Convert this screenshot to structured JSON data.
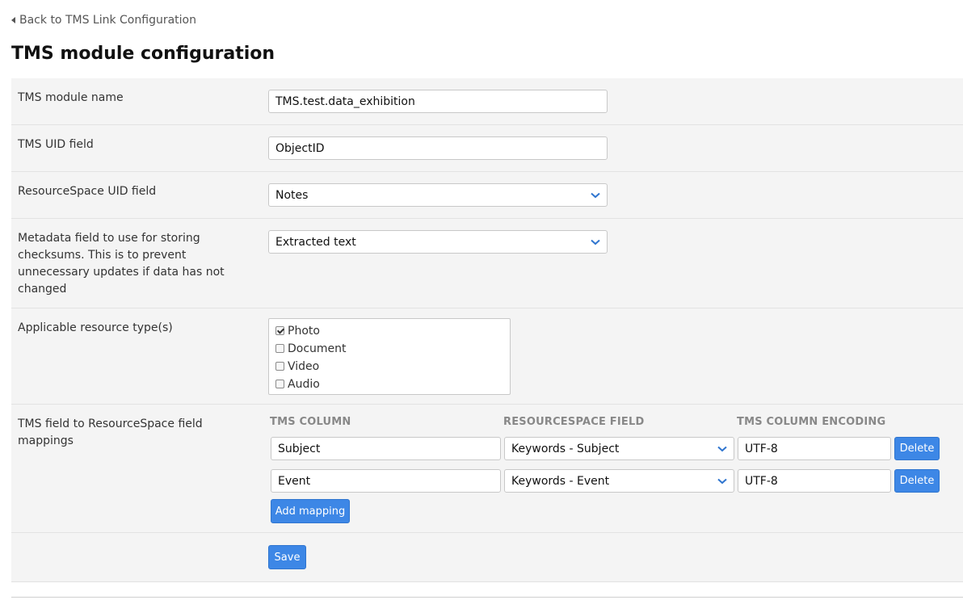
{
  "nav": {
    "back_label": "Back to TMS Link Configuration"
  },
  "page": {
    "title": "TMS module configuration"
  },
  "fields": {
    "module_name": {
      "label": "TMS module name",
      "value": "TMS.test.data_exhibition"
    },
    "uid_field": {
      "label": "TMS UID field",
      "value": "ObjectID"
    },
    "rs_uid_field": {
      "label": "ResourceSpace UID field",
      "selected": "Notes"
    },
    "checksum_field": {
      "label": "Metadata field to use for storing checksums. This is to prevent unnecessary updates if data has not changed",
      "selected": "Extracted text"
    },
    "resource_types": {
      "label": "Applicable resource type(s)",
      "items": [
        {
          "label": "Photo",
          "checked": true
        },
        {
          "label": "Document",
          "checked": false
        },
        {
          "label": "Video",
          "checked": false
        },
        {
          "label": "Audio",
          "checked": false
        }
      ]
    },
    "mappings": {
      "label": "TMS field to ResourceSpace field mappings",
      "headers": {
        "tms_column": "TMS COLUMN",
        "rs_field": "RESOURCESPACE FIELD",
        "encoding": "TMS COLUMN ENCODING"
      },
      "rows": [
        {
          "tms_column": "Subject",
          "rs_field": "Keywords - Subject",
          "encoding": "UTF-8",
          "delete_label": "Delete"
        },
        {
          "tms_column": "Event",
          "rs_field": "Keywords - Event",
          "encoding": "UTF-8",
          "delete_label": "Delete"
        }
      ],
      "add_label": "Add mapping"
    }
  },
  "actions": {
    "save_label": "Save"
  },
  "colors": {
    "accent": "#3d87e6",
    "row_bg": "#f4f4f4"
  },
  "icons": {
    "back": "caret-left-icon",
    "dropdown": "chevron-down-icon"
  }
}
